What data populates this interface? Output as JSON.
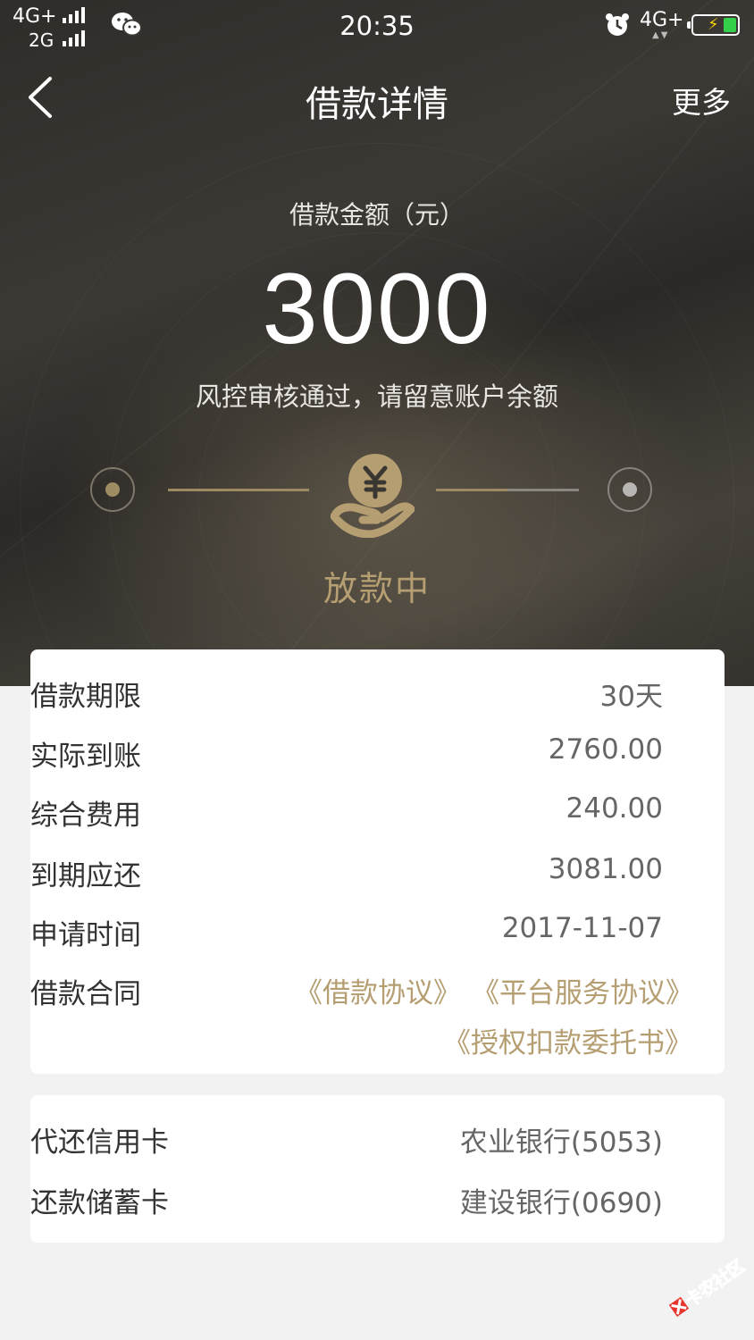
{
  "status_bar": {
    "signal_1": "4G+",
    "signal_2": "2G",
    "time": "20:35",
    "network": "4G+",
    "icons": [
      "wechat-icon",
      "alarm-icon",
      "battery-charging-icon"
    ]
  },
  "nav": {
    "title": "借款详情",
    "more_label": "更多",
    "back_icon": "chevron-left-icon"
  },
  "loan": {
    "amount_label": "借款金额（元）",
    "amount": "3000",
    "review_message": "风控审核通过，请留意账户余额",
    "status": "放款中",
    "status_icon": "yuan-coin-hand-icon"
  },
  "details": {
    "rows": [
      {
        "label": "借款期限",
        "value": "30天"
      },
      {
        "label": "实际到账",
        "value": "2760.00"
      },
      {
        "label": "综合费用",
        "value": "240.00"
      },
      {
        "label": "到期应还",
        "value": "3081.00"
      },
      {
        "label": "申请时间",
        "value": "2017-11-07"
      }
    ],
    "contract_label": "借款合同",
    "contracts": [
      "《借款协议》",
      "《平台服务协议》",
      "《授权扣款委托书》"
    ]
  },
  "cards": {
    "rows": [
      {
        "label": "代还信用卡",
        "value": "农业银行(5053)"
      },
      {
        "label": "还款储蓄卡",
        "value": "建设银行(0690)"
      }
    ]
  },
  "watermark": {
    "text": "卡农社区"
  },
  "colors": {
    "accent_gold": "#b59e71",
    "hero_dark": "#3a3733",
    "page_bg": "#f2f2f2"
  }
}
